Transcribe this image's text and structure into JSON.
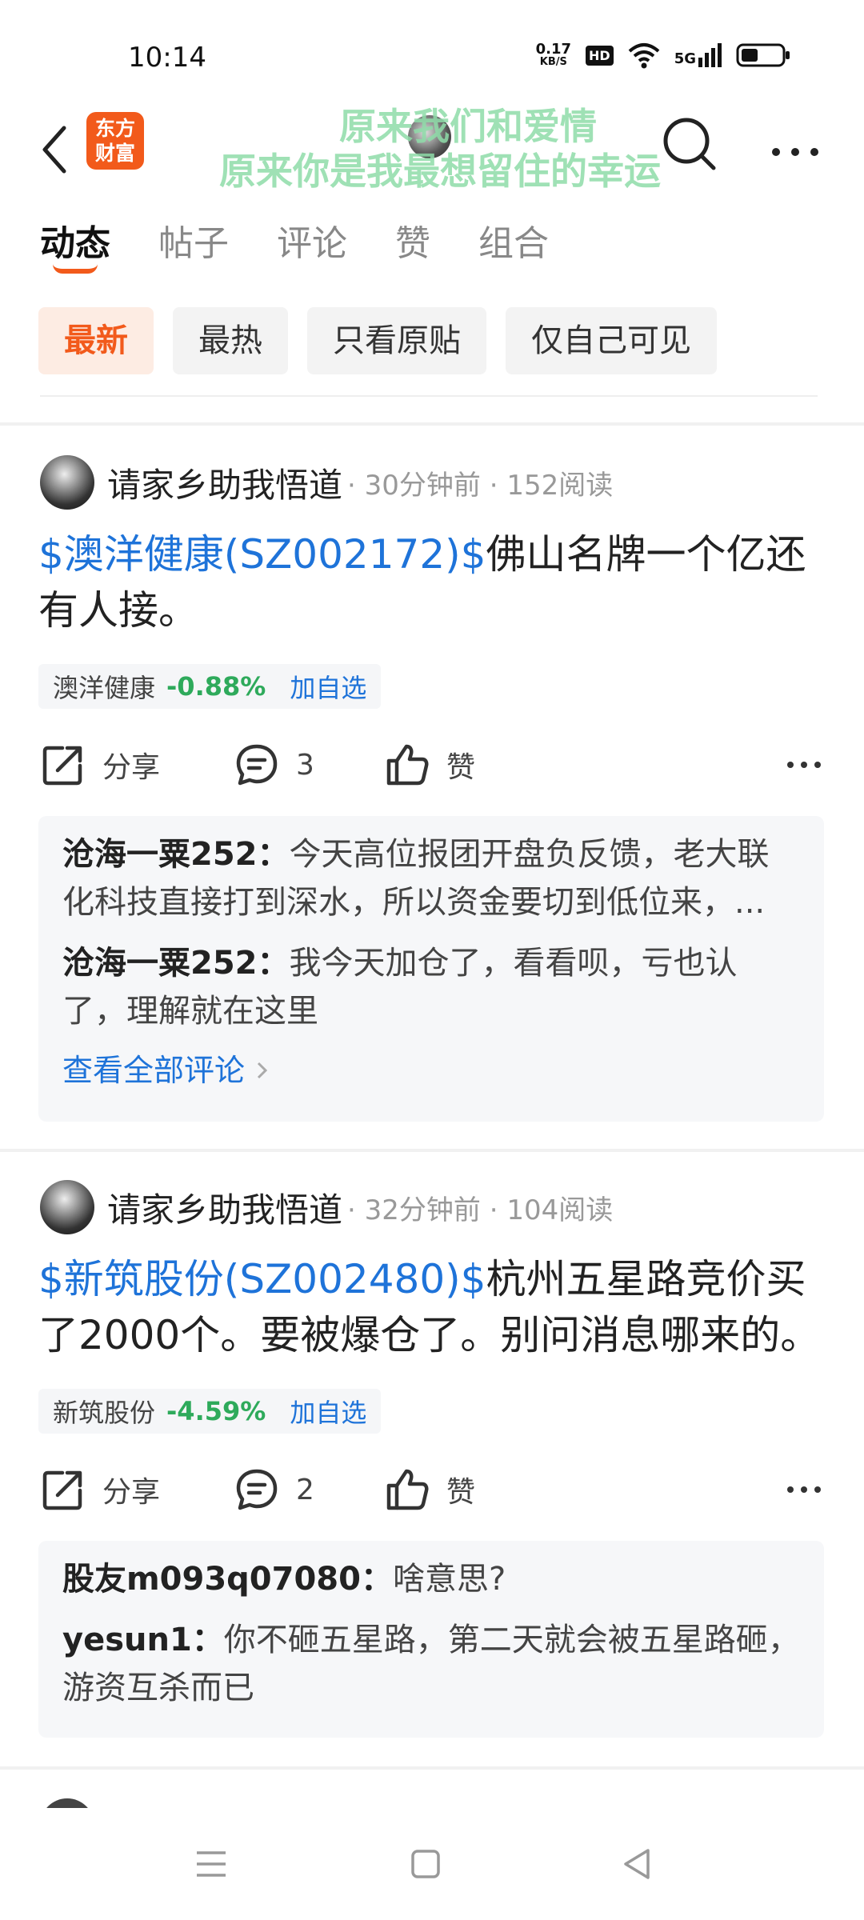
{
  "status_bar": {
    "time": "10:14",
    "net_speed_value": "0.17",
    "net_speed_unit": "KB/S",
    "hd": "HD",
    "signal": "5G"
  },
  "header": {
    "logo_line1": "东方",
    "logo_line2": "财富",
    "overlay_line1": "原来我们和爱情",
    "overlay_line2": "原来你是我最想留住的幸运"
  },
  "tabs": [
    {
      "label": "动态",
      "active": true
    },
    {
      "label": "帖子"
    },
    {
      "label": "评论"
    },
    {
      "label": "赞"
    },
    {
      "label": "组合"
    }
  ],
  "filters": [
    {
      "label": "最新",
      "active": true
    },
    {
      "label": "最热"
    },
    {
      "label": "只看原贴"
    },
    {
      "label": "仅自己可见"
    }
  ],
  "posts": [
    {
      "author": "请家乡助我悟道",
      "meta": "· 30分钟前 · 152阅读",
      "stock_link": "$澳洋健康(SZ002172)$",
      "text": "佛山名牌一个亿还有人接。",
      "stock_name": "澳洋健康",
      "stock_change": "-0.88%",
      "add_watch": "加自选",
      "share": "分享",
      "comment_count": "3",
      "like": "赞",
      "comments": [
        {
          "who": "沧海一粟252",
          "sep": "：",
          "text": "今天高位报团开盘负反馈，老大联化科技直接打到深水，所以资金要切到低位来，..."
        },
        {
          "who": "沧海一粟252",
          "sep": "：",
          "text": "我今天加仓了，看看呗，亏也认了，理解就在这里"
        }
      ],
      "view_all": "查看全部评论"
    },
    {
      "author": "请家乡助我悟道",
      "meta": "· 32分钟前 · 104阅读",
      "stock_link": "$新筑股份(SZ002480)$",
      "text": "杭州五星路竞价买了2000个。要被爆仓了。别问消息哪来的。",
      "stock_name": "新筑股份",
      "stock_change": "-4.59%",
      "add_watch": "加自选",
      "share": "分享",
      "comment_count": "2",
      "like": "赞",
      "comments": [
        {
          "who": "股友m093q07080",
          "sep": "：",
          "text": "啥意思?"
        },
        {
          "who": "yesun1",
          "sep": "：",
          "text": "你不砸五星路，第二天就会被五星路砸，游资互杀而已"
        }
      ]
    }
  ],
  "colors": {
    "accent": "#f25a1b",
    "link": "#1e73d9",
    "down": "#2eaa5b",
    "overlay": "#8fdca9"
  },
  "icons": [
    "back-icon",
    "search-icon",
    "more-icon",
    "share-icon",
    "comment-icon",
    "like-icon",
    "menu-icon",
    "home-icon",
    "back-triangle-icon",
    "wifi-icon",
    "battery-icon"
  ]
}
